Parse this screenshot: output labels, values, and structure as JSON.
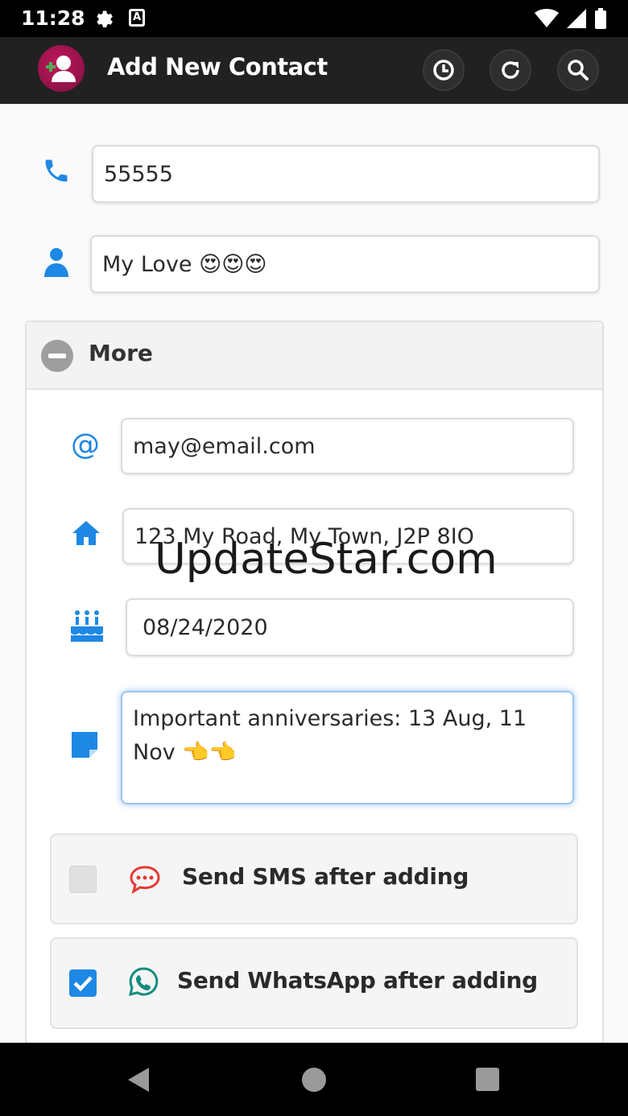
{
  "status_bar": {
    "time": "11:28",
    "icons": [
      "gear-icon",
      "a-notification-icon",
      "wifi-icon",
      "signal-icon",
      "battery-icon"
    ]
  },
  "app_bar": {
    "title": "Add New Contact",
    "actions": [
      "history-icon",
      "refresh-icon",
      "search-icon"
    ]
  },
  "form": {
    "phone_value": "55555",
    "name_value": "My Love 😍😍😍",
    "more_label": "More",
    "email_value": "may@email.com",
    "address_value": "123 My Road, My Town, J2P 8IO",
    "birthday_value": "08/24/2020",
    "note_value": "Important anniversaries: 13 Aug, 11 Nov 👈👈"
  },
  "options": {
    "sms_label": "Send SMS after adding",
    "sms_checked": false,
    "whatsapp_label": "Send WhatsApp after adding",
    "whatsapp_checked": true
  },
  "watermark": "UpdateStar.com",
  "colors": {
    "accent_blue": "#1e88e5",
    "appbar_bg": "#212121",
    "sms_red": "#e53935",
    "whatsapp_green": "#128c7e",
    "check_blue": "#1e88e5"
  }
}
